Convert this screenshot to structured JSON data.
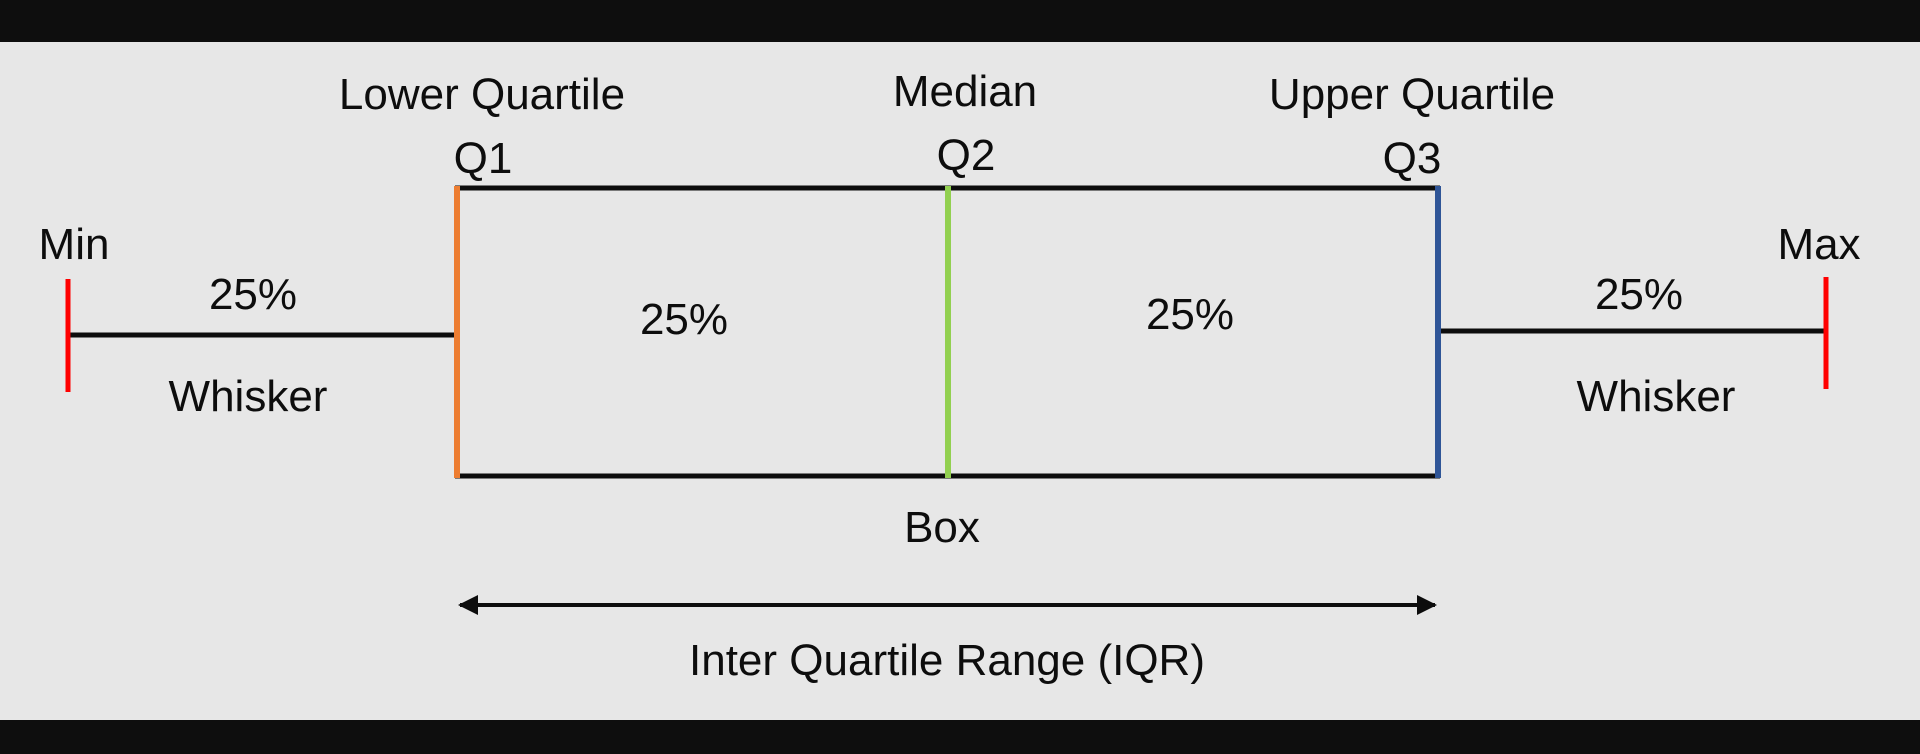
{
  "colors": {
    "frame": "#0e0e0e",
    "canvas": "#e7e7e7",
    "line": "#0d0d0d",
    "q1_marker": "#ed7d31",
    "median_marker": "#92d050",
    "q3_marker": "#2f5597",
    "extreme_marker": "#ff0000"
  },
  "labels": {
    "lower_quartile": "Lower Quartile",
    "median": "Median",
    "upper_quartile": "Upper Quartile",
    "q1": "Q1",
    "q2": "Q2",
    "q3": "Q3",
    "min": "Min",
    "max": "Max",
    "left_whisker_pct": "25%",
    "left_box_pct": "25%",
    "right_box_pct": "25%",
    "right_whisker_pct": "25%",
    "left_whisker": "Whisker",
    "right_whisker": "Whisker",
    "box": "Box",
    "iqr": "Inter Quartile Range (IQR)"
  }
}
